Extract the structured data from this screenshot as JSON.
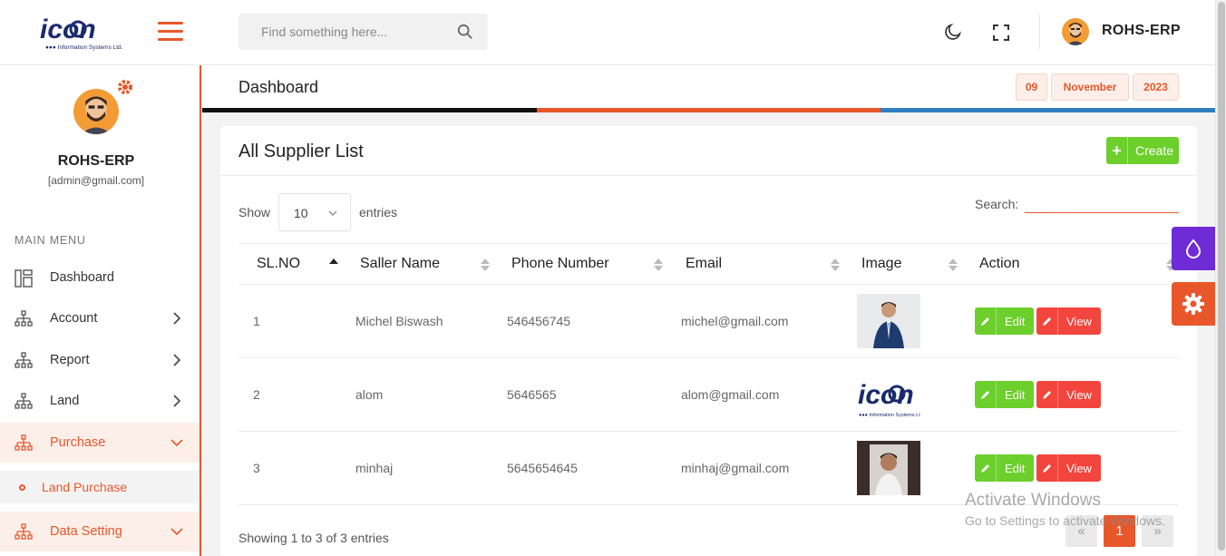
{
  "header": {
    "logo_text": "icon",
    "logo_subtext": "Information Systems Ltd.",
    "search_placeholder": "Find something here...",
    "username": "ROHS-ERP"
  },
  "sidebar": {
    "name": "ROHS-ERP",
    "email": "[admin@gmail.com]",
    "menu_title": "MAIN MENU",
    "items": [
      {
        "label": "Dashboard",
        "icon": "dashboard-icon"
      },
      {
        "label": "Account",
        "icon": "sitemap-icon"
      },
      {
        "label": "Report",
        "icon": "sitemap-icon"
      },
      {
        "label": "Land",
        "icon": "sitemap-icon"
      },
      {
        "label": "Purchase",
        "icon": "sitemap-icon"
      },
      {
        "label": "Data Setting",
        "icon": "sitemap-icon"
      }
    ],
    "sub_item": "Land Purchase"
  },
  "titlebar": {
    "title": "Dashboard",
    "day": "09",
    "month": "November",
    "year": "2023"
  },
  "card": {
    "title": "All Supplier List",
    "create_label": "Create",
    "show_label": "Show",
    "entries_value": "10",
    "entries_label": "entries",
    "search_label": "Search:",
    "columns": [
      "SL.NO",
      "Saller Name",
      "Phone Number",
      "Email",
      "Image",
      "Action"
    ],
    "rows": [
      {
        "sl": "1",
        "name": "Michel Biswash",
        "phone": "546456745",
        "email": "michel@gmail.com"
      },
      {
        "sl": "2",
        "name": "alom",
        "phone": "5646565",
        "email": "alom@gmail.com"
      },
      {
        "sl": "3",
        "name": "minhaj",
        "phone": "5645654645",
        "email": "minhaj@gmail.com"
      }
    ],
    "edit_label": "Edit",
    "view_label": "View",
    "showing": "Showing 1 to 3 of 3 entries",
    "page": "1"
  },
  "watermark": {
    "line1": "Activate Windows",
    "line2": "Go to Settings to activate Windows."
  },
  "colors": {
    "accent": "#e8572a",
    "green": "#6ccf2c",
    "red": "#f2453d",
    "purple": "#6f2bd6"
  }
}
